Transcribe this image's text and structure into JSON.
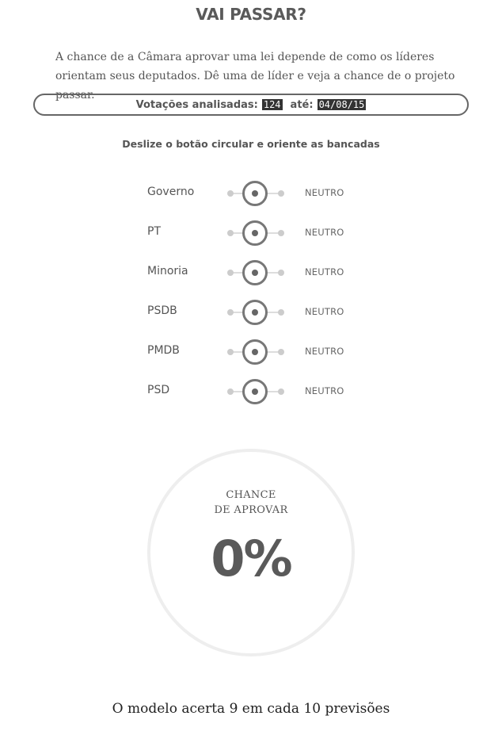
{
  "header": {
    "title": "VAI PASSAR?",
    "intro": "A chance de a Câmara aprovar uma lei depende de como os líderes orientam seus deputados. Dê uma de líder e veja a chance de o projeto passar."
  },
  "votes": {
    "label": "Votações analisadas:",
    "count": "124",
    "until_label": "até:",
    "date": "04/08/15"
  },
  "instruction": "Deslize o botão circular e oriente as bancadas",
  "sliders": [
    {
      "label": "Governo",
      "state": "NEUTRO"
    },
    {
      "label": "PT",
      "state": "NEUTRO"
    },
    {
      "label": "Minoria",
      "state": "NEUTRO"
    },
    {
      "label": "PSDB",
      "state": "NEUTRO"
    },
    {
      "label": "PMDB",
      "state": "NEUTRO"
    },
    {
      "label": "PSD",
      "state": "NEUTRO"
    }
  ],
  "result": {
    "label_line1": "CHANCE",
    "label_line2": "DE APROVAR",
    "percent": "0%"
  },
  "footer": "O modelo acerta 9 em cada 10 previsões"
}
